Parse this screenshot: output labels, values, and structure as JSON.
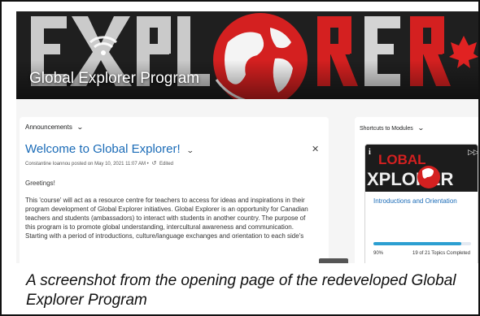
{
  "banner": {
    "logo_text": "EXPLORER",
    "title": "Global Explorer Program",
    "colors": {
      "red": "#d42020",
      "white": "#f2f2f2",
      "dark": "#1c1c1c"
    }
  },
  "announcements": {
    "header": "Announcements",
    "title": "Welcome to Global Explorer!",
    "meta_author": "Constantine Ioannou posted on May 10, 2021 11:07 AM",
    "meta_separator": "•",
    "meta_edited": "Edited",
    "greeting": "Greetings!",
    "body": "This 'course' will act as a resource centre for teachers to access for ideas and inspirations in their program development of Global Explorer initiatives. Global Explorer is an opportunity for Canadian teachers and students (ambassadors) to interact with students in another country. The purpose of this program is to promote global understanding, intercultural awareness and communication. Starting with a period of introductions, culture/language exchanges and orientation to each side's"
  },
  "shortcuts": {
    "header": "Shortcuts to Modules",
    "card": {
      "image_text_top": "LOBAL",
      "image_text_bottom": "XPLORER",
      "title": "Introductions and Orientation",
      "progress_percent": 90,
      "progress_label": "90%",
      "topics_label": "19 of 21 Topics Completed"
    }
  },
  "icons": {
    "chevron": "chevron-down-icon",
    "close": "close-icon",
    "edited": "edited-clock-icon",
    "info": "info-icon"
  },
  "caption": "A screenshot from the opening page of the redeveloped Global Explorer Program"
}
